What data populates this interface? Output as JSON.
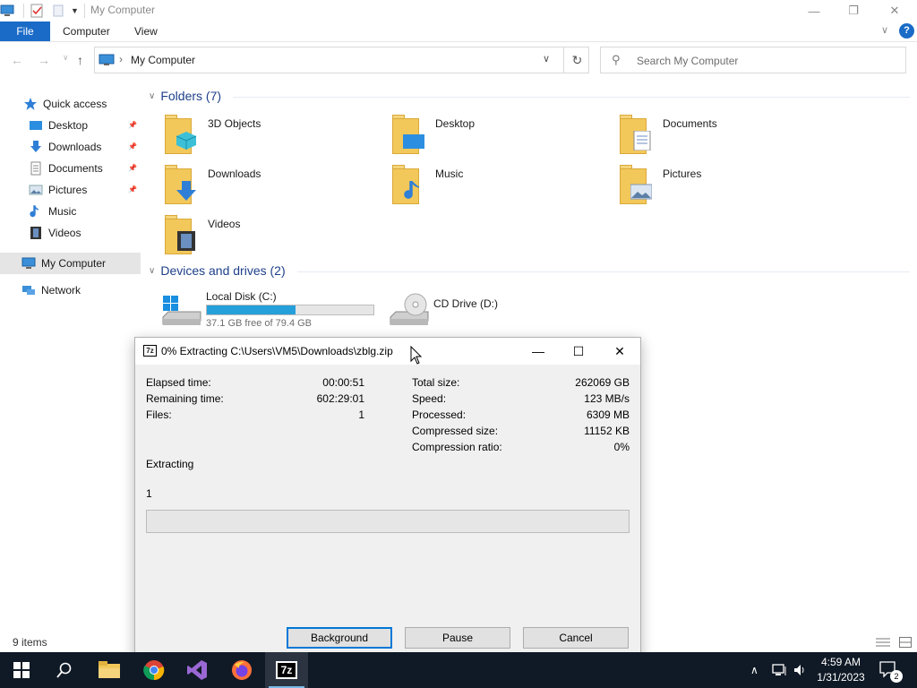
{
  "window": {
    "title": "My Computer",
    "minimize": "—",
    "maximize": "❐",
    "close": "✕"
  },
  "ribbon": {
    "tabs": [
      "File",
      "Computer",
      "View"
    ],
    "expand": "∨",
    "help": "?"
  },
  "nav": {
    "back": "←",
    "forward": "→",
    "up": "↑",
    "address_sep": "›",
    "address": "My Computer",
    "dropdown": "∨",
    "refresh": "↻",
    "search_icon": "⚲",
    "search_placeholder": "Search My Computer"
  },
  "sidebar": {
    "pin": "📌",
    "items": [
      {
        "label": "Quick access",
        "icon": "star-icon"
      },
      {
        "label": "Desktop",
        "icon": "desktop-icon",
        "pinned": true
      },
      {
        "label": "Downloads",
        "icon": "downloads-icon",
        "pinned": true
      },
      {
        "label": "Documents",
        "icon": "documents-icon",
        "pinned": true
      },
      {
        "label": "Pictures",
        "icon": "pictures-icon",
        "pinned": true
      },
      {
        "label": "Music",
        "icon": "music-icon"
      },
      {
        "label": "Videos",
        "icon": "videos-icon"
      },
      {
        "label": "My Computer",
        "icon": "computer-icon",
        "selected": true
      },
      {
        "label": "Network",
        "icon": "network-icon"
      }
    ]
  },
  "folders": {
    "chevron": "∨",
    "header": "Folders (7)",
    "items": [
      {
        "name": "3D Objects",
        "icon": "3d-objects-icon"
      },
      {
        "name": "Desktop",
        "icon": "desktop-folder-icon"
      },
      {
        "name": "Documents",
        "icon": "documents-folder-icon"
      },
      {
        "name": "Downloads",
        "icon": "downloads-folder-icon"
      },
      {
        "name": "Music",
        "icon": "music-folder-icon"
      },
      {
        "name": "Pictures",
        "icon": "pictures-folder-icon"
      },
      {
        "name": "Videos",
        "icon": "videos-folder-icon"
      }
    ]
  },
  "drives": {
    "chevron": "∨",
    "header": "Devices and drives (2)",
    "items": [
      {
        "name": "Local Disk (C:)",
        "free": "37.1 GB free of 79.4 GB",
        "used_fraction": 0.53,
        "icon": "local-disk-icon"
      },
      {
        "name": "CD Drive (D:)",
        "icon": "cd-drive-icon"
      }
    ]
  },
  "status": {
    "items": "9 items"
  },
  "dialog": {
    "logo": "7z",
    "title": "0% Extracting C:\\Users\\VM5\\Downloads\\zblg.zip",
    "minimize": "—",
    "maximize": "☐",
    "close": "✕",
    "left": [
      {
        "label": "Elapsed time:",
        "value": "00:00:51"
      },
      {
        "label": "Remaining time:",
        "value": "602:29:01"
      },
      {
        "label": "Files:",
        "value": "1"
      }
    ],
    "right": [
      {
        "label": "Total size:",
        "value": "262069 GB"
      },
      {
        "label": "Speed:",
        "value": "123 MB/s"
      },
      {
        "label": "Processed:",
        "value": "6309 MB"
      },
      {
        "label": "Compressed size:",
        "value": "11152 KB"
      },
      {
        "label": "Compression ratio:",
        "value": "0%"
      }
    ],
    "status": "Extracting",
    "current_file": "1",
    "progress": 0,
    "buttons": [
      "Background",
      "Pause",
      "Cancel"
    ]
  },
  "taskbar": {
    "apps": [
      {
        "name": "start-button",
        "icon": "windows-icon"
      },
      {
        "name": "search",
        "icon": "search-icon"
      },
      {
        "name": "file-explorer",
        "icon": "folder-icon"
      },
      {
        "name": "chrome",
        "icon": "chrome-icon"
      },
      {
        "name": "visual-studio",
        "icon": "visual-studio-icon"
      },
      {
        "name": "firefox",
        "icon": "firefox-icon"
      },
      {
        "name": "7-zip",
        "icon": "7zip-icon",
        "label": "7z",
        "active": true
      }
    ],
    "tray_chevron": "∧",
    "time": "4:59 AM",
    "date": "1/31/2023",
    "notifications": "2"
  },
  "colors": {
    "accent": "#1a6bc7",
    "drive_fill": "#26a0da",
    "folder": "#f3c85a",
    "taskbar": "#101a26",
    "group_header": "#1e3f8a"
  }
}
